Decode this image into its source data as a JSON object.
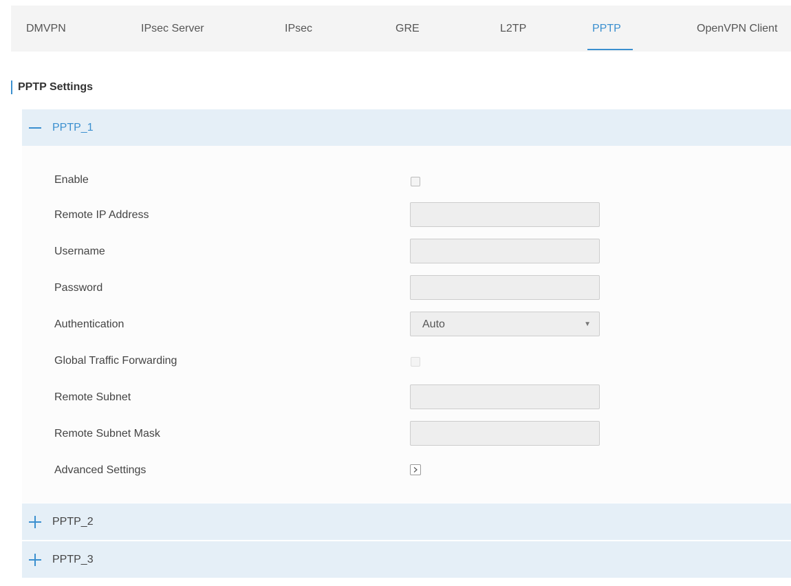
{
  "tabs": [
    {
      "label": "DMVPN",
      "active": false
    },
    {
      "label": "IPsec Server",
      "active": false
    },
    {
      "label": "IPsec",
      "active": false
    },
    {
      "label": "GRE",
      "active": false
    },
    {
      "label": "L2TP",
      "active": false
    },
    {
      "label": "PPTP",
      "active": true
    },
    {
      "label": "OpenVPN Client",
      "active": false
    }
  ],
  "section_title": "PPTP Settings",
  "accordion": [
    {
      "label": "PPTP_1",
      "expanded": true,
      "icon": "minus-icon"
    },
    {
      "label": "PPTP_2",
      "expanded": false,
      "icon": "plus-icon"
    },
    {
      "label": "PPTP_3",
      "expanded": false,
      "icon": "plus-icon"
    }
  ],
  "form": {
    "enable": {
      "label": "Enable",
      "checked": false
    },
    "remote_ip": {
      "label": "Remote IP Address",
      "value": ""
    },
    "username": {
      "label": "Username",
      "value": ""
    },
    "password": {
      "label": "Password",
      "value": ""
    },
    "authentication": {
      "label": "Authentication",
      "value": "Auto"
    },
    "global_forwarding": {
      "label": "Global Traffic Forwarding",
      "checked": false,
      "disabled": true
    },
    "remote_subnet": {
      "label": "Remote Subnet",
      "value": ""
    },
    "remote_subnet_mask": {
      "label": "Remote Subnet Mask",
      "value": ""
    },
    "advanced": {
      "label": "Advanced Settings",
      "icon": "chevron-right-icon"
    }
  },
  "colors": {
    "accent": "#3a8fcf",
    "header_bg": "#e5eff7",
    "tabbar_bg": "#f4f4f4"
  }
}
